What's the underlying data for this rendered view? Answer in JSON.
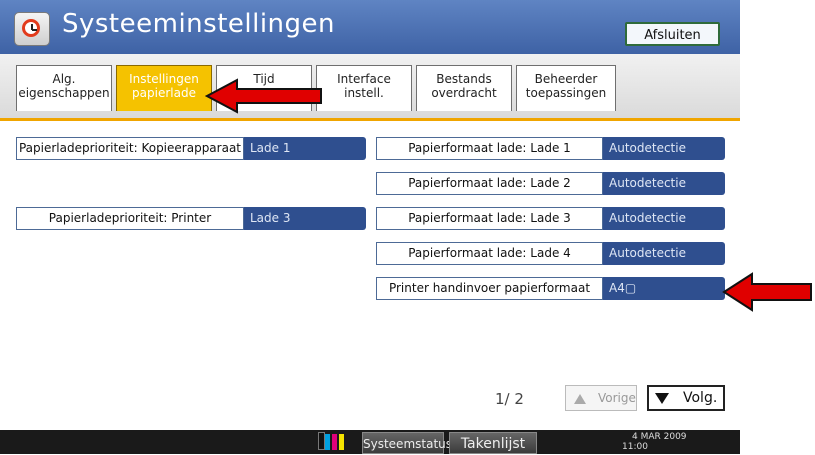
{
  "header": {
    "title": "Systeeminstellingen",
    "exit_label": "Afsluiten"
  },
  "tabs": [
    {
      "line1": "Alg.",
      "line2": "eigenschappen"
    },
    {
      "line1": "Instellingen",
      "line2": "papierlade"
    },
    {
      "line1": "Tijd",
      "line2": ""
    },
    {
      "line1": "Interface",
      "line2": "instell."
    },
    {
      "line1": "Bestands",
      "line2": "overdracht"
    },
    {
      "line1": "Beheerder",
      "line2": "toepassingen"
    }
  ],
  "left_settings": [
    {
      "label": "Papierladeprioriteit: Kopieerapparaat",
      "value": "Lade 1"
    },
    {
      "label": "Papierladeprioriteit: Printer",
      "value": "Lade 3"
    }
  ],
  "right_settings": [
    {
      "label": "Papierformaat lade: Lade 1",
      "value": "Autodetectie"
    },
    {
      "label": "Papierformaat lade: Lade 2",
      "value": "Autodetectie"
    },
    {
      "label": "Papierformaat lade: Lade 3",
      "value": "Autodetectie"
    },
    {
      "label": "Papierformaat lade: Lade 4",
      "value": "Autodetectie"
    },
    {
      "label": "Printer handinvoer papierformaat",
      "value": "A4▢"
    }
  ],
  "pagination": {
    "indicator": "1∕ 2",
    "prev_label": "Vorige",
    "next_label": "Volg."
  },
  "status_bar": {
    "toner_labels": "K C M Y",
    "system_status": "Systeemstatus",
    "task_list": "Takenlijst",
    "date": "4 MAR  2009",
    "time": "11:00"
  },
  "colors": {
    "header_blue": "#4a6db0",
    "tab_active": "#f5c200",
    "value_blue": "#2f4f8f",
    "arrow_red": "#e00000"
  }
}
